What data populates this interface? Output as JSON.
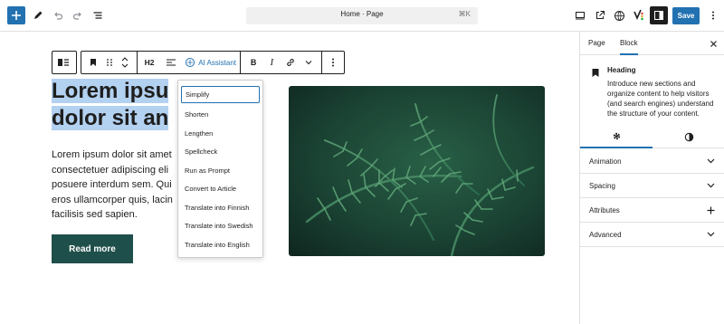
{
  "topbar": {
    "document_title": "Home · Page",
    "shortcut": "⌘K",
    "save_label": "Save"
  },
  "block_toolbar": {
    "heading_level": "H2",
    "ai_assistant_label": "AI Assistant"
  },
  "content": {
    "heading_line1": "Lorem ipsu",
    "heading_line2": "dolor sit an",
    "paragraph_lines": [
      "Lorem ipsum dolor sit amet",
      "consectetuer adipiscing eli",
      "posuere interdum sem. Qui",
      "eros ullamcorper quis, lacin",
      "facilisis sed sapien."
    ],
    "button_label": "Read more"
  },
  "ai_menu": {
    "items": [
      "Simplify",
      "Shorten",
      "Lengthen",
      "Spellcheck",
      "Run as Prompt",
      "Convert to Article",
      "Translate into Finnish",
      "Translate into Swedish",
      "Translate into English"
    ]
  },
  "sidebar": {
    "tabs": [
      "Page",
      "Block"
    ],
    "active_tab": "Block",
    "block_title": "Heading",
    "block_description": "Introduce new sections and organize content to help visitors (and search engines) understand the structure of your content.",
    "panels": [
      "Animation",
      "Spacing",
      "Attributes",
      "Advanced"
    ]
  },
  "colors": {
    "accent": "#2271b1",
    "button_bg": "#1f4f4a",
    "selection": "#b3d1f0"
  }
}
